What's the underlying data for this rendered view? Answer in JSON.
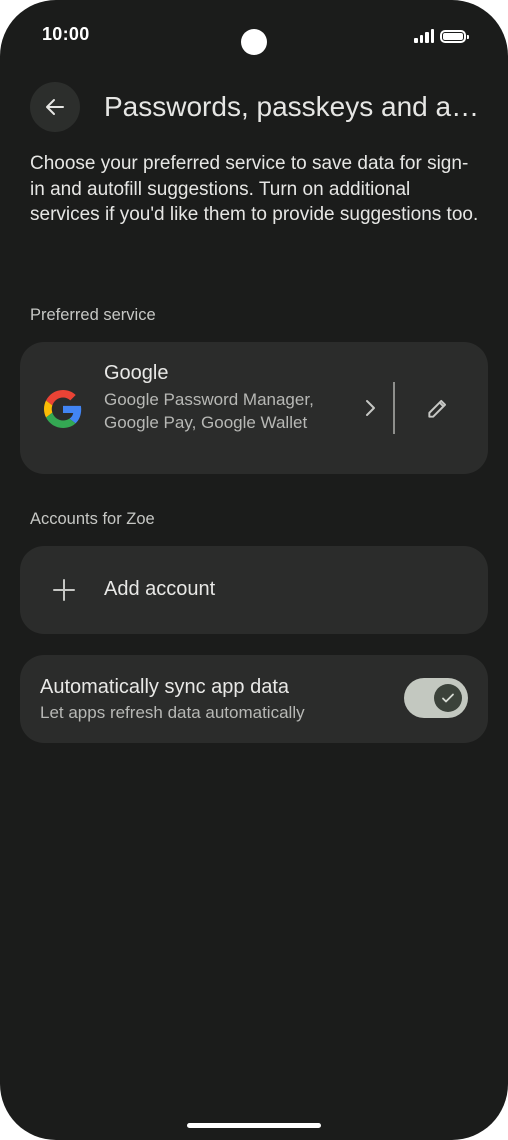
{
  "status_bar": {
    "time": "10:00"
  },
  "header": {
    "title": "Passwords, passkeys and accounts"
  },
  "intro_text": "Choose your preferred service to save data for sign-in and autofill suggestions. Turn on additional services if you'd like them to provide suggestions too.",
  "preferred_service": {
    "header": "Preferred service",
    "name": "Google",
    "description": "Google Password Manager, Google Pay, Google Wallet"
  },
  "accounts": {
    "header": "Accounts for Zoe",
    "add_label": "Add account"
  },
  "sync": {
    "title": "Automatically sync app data",
    "subtitle": "Let apps refresh data automatically",
    "enabled": true
  },
  "colors": {
    "background": "#1b1c1b",
    "card": "#2b2c2b",
    "toggle_track": "#c3c8c0",
    "toggle_knob": "#3b423a"
  }
}
